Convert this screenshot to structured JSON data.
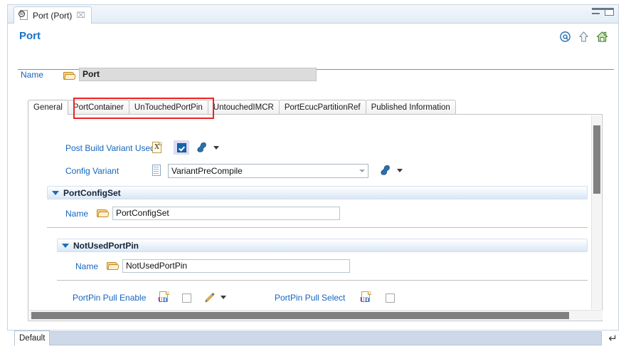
{
  "window": {
    "editor_tab": {
      "label": "Port (Port)",
      "icon": "ecu-configuration-document-icon",
      "close_label": "⌧"
    },
    "minimize_label": "minimize",
    "maximize_label": "maximize"
  },
  "form": {
    "title": "Port",
    "header_icons": [
      {
        "name": "link-at-icon",
        "glyph": "@"
      },
      {
        "name": "up-arrow-icon",
        "glyph": "⇧"
      },
      {
        "name": "home-icon",
        "glyph": "⌂"
      }
    ],
    "name_row": {
      "label": "Name",
      "value": "Port",
      "icon": "folder-icon"
    }
  },
  "tabs": [
    {
      "label": "General",
      "active": true
    },
    {
      "label": "PortContainer",
      "active": false
    },
    {
      "label": "UnTouchedPortPin",
      "active": false
    },
    {
      "label": "UntouchedIMCR",
      "active": false
    },
    {
      "label": "PortEcucPartitionRef",
      "active": false
    },
    {
      "label": "Published Information",
      "active": false
    }
  ],
  "highlight": {
    "name": "red-annotation-box",
    "color": "#ee2222",
    "covers": [
      "PortContainer",
      "UnTouchedPortPin"
    ]
  },
  "general": {
    "post_build_variant": {
      "label": "Post Build Variant Used",
      "doc_icon": "excel-document-icon",
      "checked": true,
      "tool_icon": "wrench-icon",
      "menu_caret": "▾"
    },
    "config_variant": {
      "label": "Config Variant",
      "doc_icon": "sheet-document-icon",
      "value": "VariantPreCompile",
      "tool_icon": "wrench-icon",
      "menu_caret": "▾"
    },
    "port_config_set": {
      "title": "PortConfigSet",
      "expanded": true,
      "name_label": "Name",
      "name_value": "PortConfigSet",
      "name_icon": "folder-icon"
    },
    "not_used_port_pin": {
      "title": "NotUsedPortPin",
      "expanded": true,
      "name_label": "Name",
      "name_value": "NotUsedPortPin",
      "name_icon": "folder-icon",
      "fields": [
        {
          "label": "PortPin Pull Enable",
          "doc_icon": "ud-document-icon",
          "checked": false,
          "edit_icon": "pencil-icon",
          "menu_caret": "▾",
          "has_editor": true
        },
        {
          "label": "PortPin Pull Select",
          "doc_icon": "ud-document-icon",
          "checked": false,
          "has_editor": false
        }
      ]
    }
  },
  "scrollbars": {
    "vertical_name": "vertical-scrollbar",
    "horizontal_name": "horizontal-scrollbar"
  },
  "status_bar": {
    "default_tab_label": "Default",
    "enter_glyph": "↵"
  }
}
